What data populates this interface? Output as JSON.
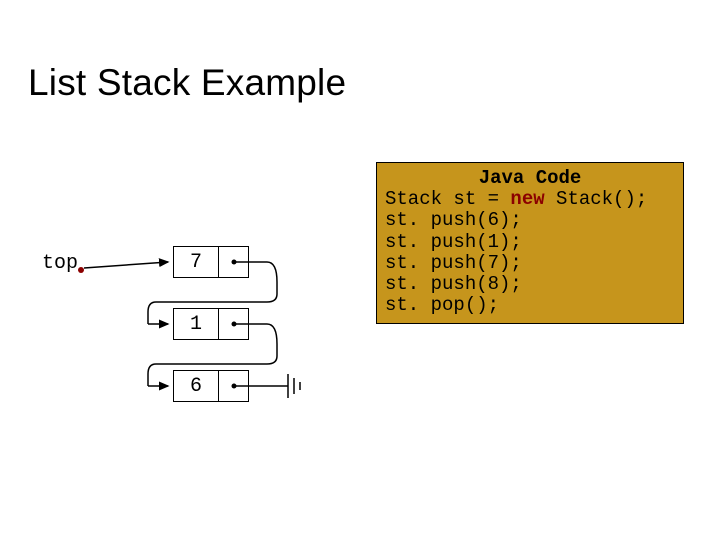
{
  "title": "List Stack Example",
  "top_label": "top",
  "nodes": [
    {
      "value": "7"
    },
    {
      "value": "1"
    },
    {
      "value": "6"
    }
  ],
  "code": {
    "title": "Java Code",
    "lines": [
      {
        "pre": "Stack st = ",
        "kw": "new",
        "post": " Stack();"
      },
      {
        "pre": "st. push(6);",
        "kw": "",
        "post": ""
      },
      {
        "pre": "st. push(1);",
        "kw": "",
        "post": ""
      },
      {
        "pre": "st. push(7);",
        "kw": "",
        "post": ""
      },
      {
        "pre": "st. push(8);",
        "kw": "",
        "post": ""
      },
      {
        "pre": "st. pop();",
        "kw": "",
        "post": ""
      }
    ]
  }
}
